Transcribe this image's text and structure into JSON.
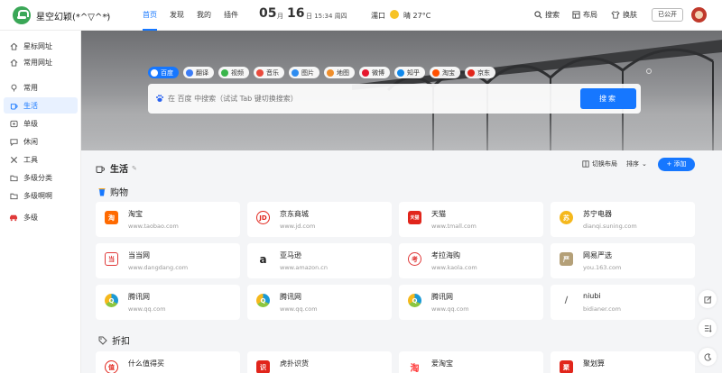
{
  "header": {
    "site_name": "星空幻颖(*^▽^*)",
    "nav": [
      "首页",
      "发现",
      "我的",
      "插件"
    ],
    "date": {
      "month_num": "05",
      "month_label": "月",
      "day_num": "16",
      "day_suffix": "日 15:34 周四"
    },
    "city": "濡口",
    "weather": "晴 27°C",
    "tools": {
      "search": "搜索",
      "layout": "布局",
      "skin": "换肤"
    },
    "public_label": "已公开"
  },
  "sidebar": {
    "items": [
      {
        "label": "星标网址",
        "icon": "home-icon"
      },
      {
        "label": "常用网址",
        "icon": "home-icon"
      },
      {
        "label": "常用",
        "icon": "pin-icon"
      },
      {
        "label": "生活",
        "icon": "coffee-icon",
        "active": true
      },
      {
        "label": "单级",
        "icon": "disk-icon"
      },
      {
        "label": "休闲",
        "icon": "chat-icon"
      },
      {
        "label": "工具",
        "icon": "tools-icon"
      },
      {
        "label": "多级分类",
        "icon": "folder-icon"
      },
      {
        "label": "多级啊啊",
        "icon": "folder-icon"
      },
      {
        "label": "多级",
        "icon": "car-icon"
      }
    ]
  },
  "search": {
    "engines": [
      {
        "label": "百度",
        "color": "#2b64f0"
      },
      {
        "label": "翻译",
        "color": "#3b7cf6"
      },
      {
        "label": "视频",
        "color": "#39b54a"
      },
      {
        "label": "音乐",
        "color": "#e94a3c"
      },
      {
        "label": "图片",
        "color": "#2d8cf0"
      },
      {
        "label": "地图",
        "color": "#ef8e2b"
      },
      {
        "label": "微博",
        "color": "#e6162d"
      },
      {
        "label": "知乎",
        "color": "#0f88eb"
      },
      {
        "label": "淘宝",
        "color": "#ff5000"
      },
      {
        "label": "京东",
        "color": "#e1251b"
      }
    ],
    "placeholder": "在 百度 中搜索（试试 Tab 键切换搜索）",
    "button": "搜索"
  },
  "main": {
    "section_title": "生活",
    "switch_layout": "切换布局",
    "sort": "排序",
    "add": "+ 添加",
    "groups": [
      {
        "title": "购物",
        "cards": [
          {
            "name": "淘宝",
            "url": "www.taobao.com",
            "icon_text": "淘",
            "color": "#ff6a00"
          },
          {
            "name": "京东商城",
            "url": "www.jd.com",
            "icon_text": "JD",
            "color": "#e1251b"
          },
          {
            "name": "天猫",
            "url": "www.tmall.com",
            "icon_text": "天猫",
            "color": "#e1251b"
          },
          {
            "name": "苏宁电器",
            "url": "dianqi.suning.com",
            "icon_text": "苏",
            "color": "#f5b81c"
          },
          {
            "name": "当当网",
            "url": "www.dangdang.com",
            "icon_text": "当",
            "color": "#e03a3a"
          },
          {
            "name": "亚马逊",
            "url": "www.amazon.cn",
            "icon_text": "a",
            "color": "#222222"
          },
          {
            "name": "考拉海购",
            "url": "www.kaola.com",
            "icon_text": "考",
            "color": "#e03a3a"
          },
          {
            "name": "网易严选",
            "url": "you.163.com",
            "icon_text": "严",
            "color": "#b4a078"
          },
          {
            "name": "腾讯网",
            "url": "www.qq.com",
            "icon_text": "Q",
            "color": "#1b9ad6"
          },
          {
            "name": "腾讯网",
            "url": "www.qq.com",
            "icon_text": "Q",
            "color": "#1b9ad6"
          },
          {
            "name": "腾讯网",
            "url": "www.qq.com",
            "icon_text": "Q",
            "color": "#1b9ad6"
          },
          {
            "name": "niubi",
            "url": "bidianer.com",
            "icon_text": "∕",
            "color": "#666666"
          }
        ]
      },
      {
        "title": "折扣",
        "cards": [
          {
            "name": "什么值得买",
            "url": "",
            "icon_text": "值",
            "color": "#e1251b"
          },
          {
            "name": "虎扑识货",
            "url": "",
            "icon_text": "识",
            "color": "#e1251b"
          },
          {
            "name": "爱淘宝",
            "url": "",
            "icon_text": "淘",
            "color": "#ff3c3c"
          },
          {
            "name": "聚划算",
            "url": "",
            "icon_text": "聚",
            "color": "#e1251b"
          }
        ]
      }
    ]
  }
}
